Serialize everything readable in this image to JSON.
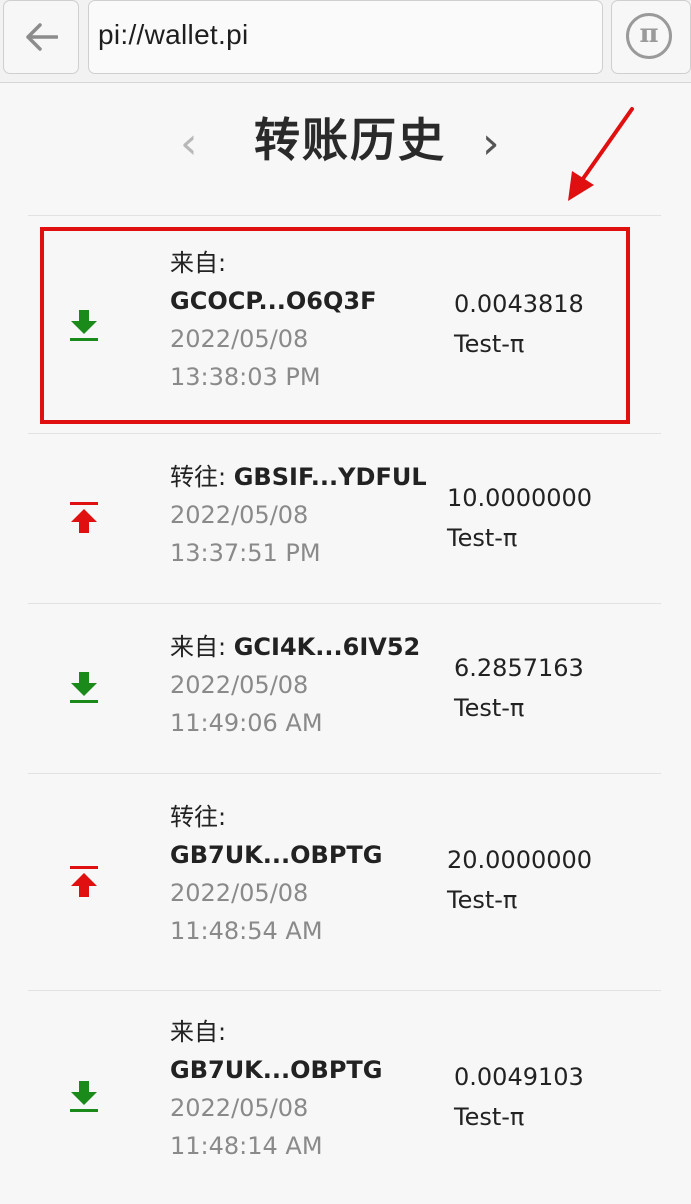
{
  "browser": {
    "url": "pi://wallet.pi",
    "pi_symbol": "π"
  },
  "header": {
    "title": "转账历史",
    "prev_glyph": "‹",
    "next_glyph": "›"
  },
  "transactions": [
    {
      "direction": "in",
      "label": "来自:",
      "address": "GCOCP...O6Q3F",
      "date": "2022/05/08",
      "time": "13:38:03 PM",
      "amount": "0.0043818",
      "currency": "Test-π",
      "highlighted": true
    },
    {
      "direction": "out",
      "label": "转往:",
      "address": "GBSIF...YDFUL",
      "date": "2022/05/08",
      "time": "13:37:51 PM",
      "amount": "10.0000000",
      "currency": "Test-π"
    },
    {
      "direction": "in",
      "label": "来自:",
      "address": "GCI4K...6IV52",
      "date": "2022/05/08",
      "time": "11:49:06 AM",
      "amount": "6.2857163",
      "currency": "Test-π"
    },
    {
      "direction": "out",
      "label": "转往:",
      "address": "GB7UK...OBPTG",
      "date": "2022/05/08",
      "time": "11:48:54 AM",
      "amount": "20.0000000",
      "currency": "Test-π"
    },
    {
      "direction": "in",
      "label": "来自:",
      "address": "GB7UK...OBPTG",
      "date": "2022/05/08",
      "time": "11:48:14 AM",
      "amount": "0.0049103",
      "currency": "Test-π"
    }
  ],
  "colors": {
    "incoming": "#1a8a1a",
    "outgoing": "#e01010",
    "annotation": "#e01010"
  }
}
